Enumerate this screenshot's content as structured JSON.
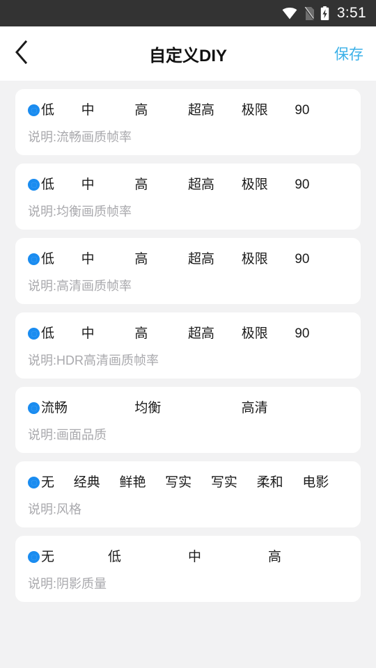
{
  "status_bar": {
    "icons": [
      "wifi-icon",
      "no-sim-icon",
      "battery-charging-icon"
    ],
    "clock": "3:51",
    "background": "#333333"
  },
  "title_bar": {
    "back_icon": "chevron-left-icon",
    "title": "自定义DIY",
    "save_label": "保存",
    "save_color": "#3ab0e8"
  },
  "theme": {
    "page_background": "#f2f2f3",
    "card_background": "#ffffff",
    "radio_accent": "#1a8cf0",
    "desc_color": "#a9a9ad"
  },
  "settings": [
    {
      "id": "smooth-frame-rate",
      "options": [
        "低",
        "中",
        "高",
        "超高",
        "极限",
        "90"
      ],
      "selected": 0,
      "desc": "说明:流畅画质帧率"
    },
    {
      "id": "balanced-frame-rate",
      "options": [
        "低",
        "中",
        "高",
        "超高",
        "极限",
        "90"
      ],
      "selected": 0,
      "desc": "说明:均衡画质帧率"
    },
    {
      "id": "hd-frame-rate",
      "options": [
        "低",
        "中",
        "高",
        "超高",
        "极限",
        "90"
      ],
      "selected": 0,
      "desc": "说明:高清画质帧率"
    },
    {
      "id": "hdr-hd-frame-rate",
      "options": [
        "低",
        "中",
        "高",
        "超高",
        "极限",
        "90"
      ],
      "selected": 0,
      "desc": "说明:HDR高清画质帧率"
    },
    {
      "id": "picture-quality",
      "options": [
        "流畅",
        "均衡",
        "高清"
      ],
      "selected": 0,
      "desc": "说明:画面品质"
    },
    {
      "id": "style",
      "options": [
        "无",
        "经典",
        "鲜艳",
        "写实",
        "写实",
        "柔和",
        "电影"
      ],
      "selected": 0,
      "desc": "说明:风格"
    },
    {
      "id": "shadow-quality",
      "options": [
        "无",
        "低",
        "中",
        "高"
      ],
      "selected": 0,
      "desc": "说明:阴影质量"
    }
  ]
}
